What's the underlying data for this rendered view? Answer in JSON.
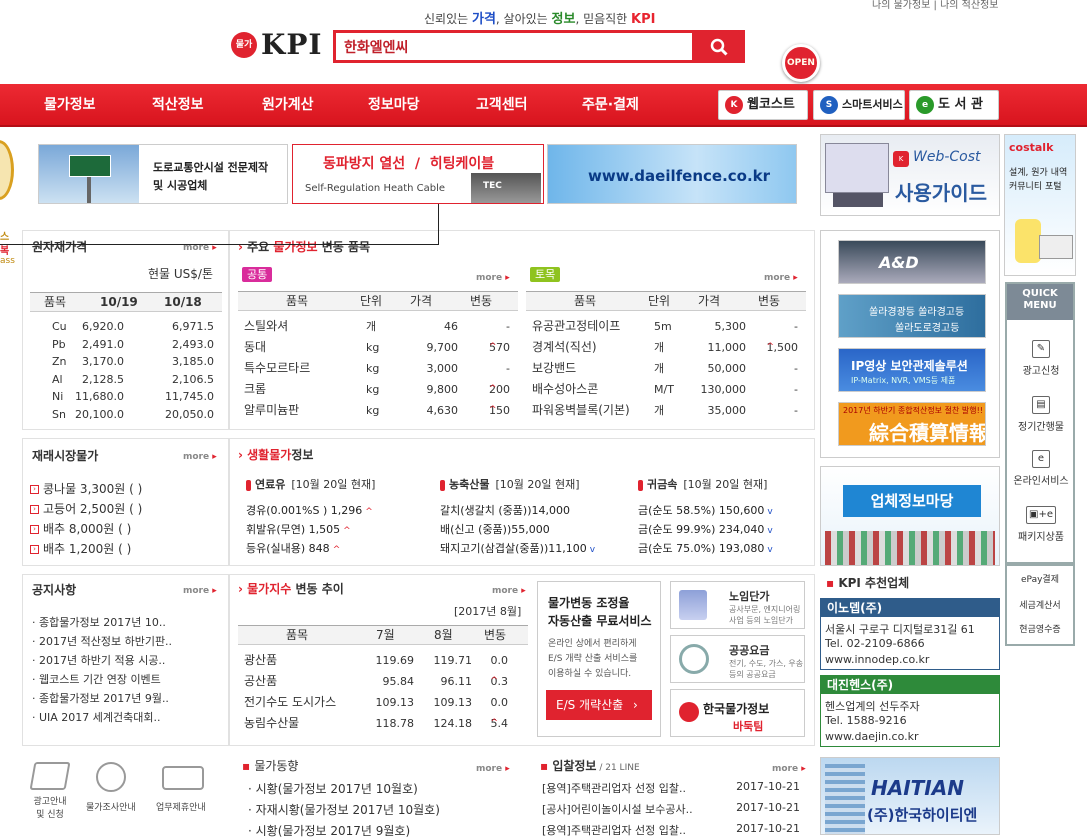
{
  "header": {
    "slogan": {
      "p1": "신뢰있는 ",
      "w1": "가격",
      "p2": ", 살아있는 ",
      "w2": "정보",
      "p3": ", 믿음직한 ",
      "w3": "KPI"
    },
    "top_links": "나의 물가정보 | 나의 적산정보",
    "logo_seal": "물가",
    "logo_text": "KPI",
    "search_value": "한화엘엔씨",
    "search_icon": "search-icon"
  },
  "nav": {
    "items": [
      "물가정보",
      "적산정보",
      "원가계산",
      "정보마당",
      "고객센터",
      "주문·결제"
    ],
    "webcost": "웹코스트",
    "smartservice": "스마트서비스",
    "library": "도 서 관",
    "open_badge": "OPEN"
  },
  "banners": {
    "road": {
      "line1": "도로교통안시설 전문제작",
      "line2": "및 시공업체"
    },
    "heat": {
      "title1": "동파방지 열선",
      "title2": "히팅케이블",
      "sub": "Self-Regulation Heath Cable",
      "brand": "TEC"
    },
    "fence": "www.daeilfence.co.kr",
    "webcost_guide": {
      "brand": "Web-Cost",
      "title": "사용가이드"
    },
    "costalk": {
      "brand": "costalk",
      "line1": "설계, 원가 내역",
      "line2": "커뮤니티 포털"
    }
  },
  "raw_material": {
    "title": "원자재가격",
    "more": "more",
    "unit": "현물 US$/톤",
    "headers": [
      "품목",
      "10/19",
      "10/18"
    ],
    "rows": [
      [
        "Cu",
        "6,920.0",
        "6,971.5"
      ],
      [
        "Pb",
        "2,491.0",
        "2,493.0"
      ],
      [
        "Zn",
        "3,170.0",
        "3,185.0"
      ],
      [
        "Al",
        "2,128.5",
        "2,106.5"
      ],
      [
        "Ni",
        "11,680.0",
        "11,745.0"
      ],
      [
        "Sn",
        "20,100.0",
        "20,050.0"
      ]
    ]
  },
  "main_items": {
    "title_pre": "주요 ",
    "title_red": "물가정보",
    "title_post": " 변동 품목",
    "left_tag": "공통",
    "right_tag": "토목",
    "more": "more",
    "headers": [
      "품목",
      "단위",
      "가격",
      "변동"
    ],
    "left_rows": [
      {
        "name": "스틸와셔",
        "unit": "개",
        "price": "46",
        "change": "-",
        "dir": ""
      },
      {
        "name": "동대",
        "unit": "kg",
        "price": "9,700",
        "change": "570",
        "dir": "up"
      },
      {
        "name": "특수모르타르",
        "unit": "kg",
        "price": "3,000",
        "change": "-",
        "dir": ""
      },
      {
        "name": "크롬",
        "unit": "kg",
        "price": "9,800",
        "change": "200",
        "dir": "up"
      },
      {
        "name": "알루미늄판",
        "unit": "kg",
        "price": "4,630",
        "change": "150",
        "dir": "up"
      }
    ],
    "right_rows": [
      {
        "name": "유공관고정테이프",
        "unit": "5m",
        "price": "5,300",
        "change": "-",
        "dir": ""
      },
      {
        "name": "경계석(직선)",
        "unit": "개",
        "price": "11,000",
        "change": "1,500",
        "dir": "up"
      },
      {
        "name": "보강밴드",
        "unit": "개",
        "price": "50,000",
        "change": "-",
        "dir": ""
      },
      {
        "name": "배수성아스콘",
        "unit": "M/T",
        "price": "130,000",
        "change": "-",
        "dir": ""
      },
      {
        "name": "파워옹벽블록(기본)",
        "unit": "개",
        "price": "35,000",
        "change": "-",
        "dir": ""
      }
    ]
  },
  "traditional": {
    "title": "재래시장물가",
    "more": "more",
    "items": [
      "콩나물 3,300원 ( )",
      "고등어 2,500원 ( )",
      "배추 8,000원 ( )",
      "배추 1,200원 ( )"
    ]
  },
  "living": {
    "title_red": "생활물가",
    "title_post": "정보",
    "col1": {
      "title": "연료유",
      "date": "[10월 20일 현재]",
      "rows": [
        {
          "text": "경유(0.001%S ) 1,296",
          "dir": "up"
        },
        {
          "text": "휘발유(무연) 1,505",
          "dir": "up"
        },
        {
          "text": "등유(실내용) 848",
          "dir": "up"
        }
      ]
    },
    "col2": {
      "title": "농축산물",
      "date": "[10월 20일 현재]",
      "rows": [
        {
          "text": "갈치(생갈치 (중품))14,000",
          "dir": ""
        },
        {
          "text": "배(신고 (중품))55,000",
          "dir": ""
        },
        {
          "text": "돼지고기(삼겹살(중품))11,100",
          "dir": "down"
        }
      ]
    },
    "col3": {
      "title": "귀금속",
      "date": "[10월 20일 현재]",
      "rows": [
        {
          "text": "금(순도 58.5%) 150,600",
          "dir": "down"
        },
        {
          "text": "금(순도 99.9%) 234,040",
          "dir": "down"
        },
        {
          "text": "금(순도 75.0%) 193,080",
          "dir": "down"
        }
      ]
    }
  },
  "notice": {
    "title": "공지사항",
    "more": "more",
    "items": [
      "종합물가정보 2017년 10..",
      "2017년 적산정보 하반기판..",
      "2017년 하반기 적용 시공..",
      "웹코스트 기간 연장 이벤트",
      "종합물가정보 2017년 9월..",
      "UIA 2017 세계건축대회.."
    ]
  },
  "index": {
    "title_red": "물가지수",
    "title_post": " 변동 추이",
    "more": "more",
    "period": "[2017년 8월]",
    "headers": [
      "품목",
      "7월",
      "8월",
      "변동"
    ],
    "rows": [
      {
        "name": "광산품",
        "m7": "119.69",
        "m8": "119.71",
        "change": "0.0",
        "dir": ""
      },
      {
        "name": "공산품",
        "m7": "95.84",
        "m8": "96.11",
        "change": "0.3",
        "dir": "up"
      },
      {
        "name": "전기수도 도시가스",
        "m7": "109.13",
        "m8": "109.13",
        "change": "0.0",
        "dir": ""
      },
      {
        "name": "농림수산물",
        "m7": "118.78",
        "m8": "124.18",
        "change": "5.4",
        "dir": "up"
      }
    ]
  },
  "es_box": {
    "title1": "물가변동 조정율",
    "title2": "자동산출 무료서비스",
    "desc": [
      "온라인 상에서 편리하게",
      "E/S 개략 산출 서비스를",
      "이용하실 수 있습니다."
    ],
    "button": "E/S 개략산출"
  },
  "mini_banners": {
    "labor": {
      "title": "노임단가",
      "desc1": "공사부문, 엔지니어링",
      "desc2": "사업 등의 노임단가"
    },
    "fee": {
      "title": "공공요금",
      "desc1": "전기, 수도, 가스, 우송",
      "desc2": "등의 공공요금"
    },
    "kpi_team": {
      "line1": "한국물가정보",
      "line2": "바둑팀"
    }
  },
  "bottom_icons": [
    "광고안내 및 신청",
    "물가조사안내",
    "업무제휴안내"
  ],
  "price_trend": {
    "title": "물가동향",
    "more": "more",
    "items": [
      "시황(물가정보 2017년 10월호)",
      "자재시황(물가정보 2017년 10월호)",
      "시황(물가정보 2017년 9월호)"
    ]
  },
  "bid": {
    "title": "입찰정보",
    "count": " / 21 LINE",
    "more": "more",
    "items": [
      {
        "type": "[용역]",
        "text": "주택관리업자 선정 입찰..",
        "date": "2017-10-21"
      },
      {
        "type": "[공사]",
        "text": "어린이놀이시설 보수공사..",
        "date": "2017-10-21"
      },
      {
        "type": "[용역]",
        "text": "주택관리업자 선정 입찰..",
        "date": "2017-10-21"
      }
    ]
  },
  "side": {
    "ad": "A&D",
    "solar": {
      "line1": "쏠라경광등 쏠라경고등",
      "line2": "쏠라도로경고등"
    },
    "ip": {
      "line1": "IP영상 보안관제솔루션",
      "line2": "IP-Matrix, NVR, VMS등 제품"
    },
    "estimate": {
      "line1": "2017년 하반기 종합적산정보 절찬 발행!!",
      "line2": "綜合積算情報"
    },
    "company_info": "업체정보마당",
    "recommend_title": "KPI 추천업체",
    "companies": [
      {
        "name": "이노뎁(주)",
        "addr": "서울시 구로구 디지털로31길 61",
        "tel": "Tel. 02-2109-6866",
        "web": "www.innodep.co.kr"
      },
      {
        "name": "대진헨스(주)",
        "addr": "헨스업계의 선두주자",
        "tel": "Tel. 1588-9216",
        "web": "www.daejin.co.kr"
      }
    ],
    "haitian": {
      "brand": "HAITIAN",
      "name": "(주)한국하이티엔"
    }
  },
  "quick_menu": {
    "title": "QUICK MENU",
    "items": [
      "광고신청",
      "정기간행물",
      "온라인서비스",
      "패키지상품"
    ],
    "links": [
      "ePay결제",
      "세금계산서",
      "현금영수증"
    ]
  },
  "left_edge": {
    "l1": "스",
    "l2": "복",
    "l3": "ass"
  }
}
